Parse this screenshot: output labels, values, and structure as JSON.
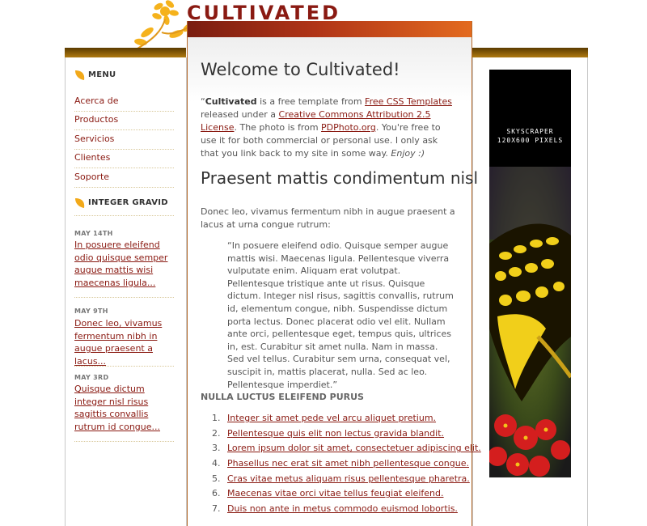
{
  "site": {
    "logo_text": "CULTIVATED"
  },
  "sidebar": {
    "menu_heading": "MENU",
    "menu_items": [
      "Acerca de",
      "Productos",
      "Servicios",
      "Clientes",
      "Soporte"
    ],
    "news_heading": "INTEGER GRAVID",
    "news": [
      {
        "date": "MAY 14TH",
        "text": "In posuere eleifend odio quisque semper augue mattis wisi maecenas ligula..."
      },
      {
        "date": "MAY 9TH",
        "text": "Donec leo, vivamus fermentum nibh in augue praesent a lacus..."
      },
      {
        "date": "MAY 3RD",
        "text": "Quisque dictum integer nisl risus sagittis convallis rutrum id congue..."
      }
    ]
  },
  "main": {
    "title": "Welcome to Cultivated!",
    "intro": {
      "quote_open": "“",
      "brand": "Cultivated",
      "t1": " is a free template from ",
      "link1": "Free CSS Templates",
      "t2": " released under a ",
      "link2": "Creative Commons Attribution 2.5 License",
      "t3": ". The photo is from ",
      "link3": "PDPhoto.org",
      "t4": ". You're free to use it for both commercial or personal use. I only ask that you link back to my site in some way. ",
      "enjoy": "Enjoy :)"
    },
    "subtitle": "Praesent mattis condimentum nisl",
    "paragraph": "Donec leo, vivamus fermentum nibh in augue praesent a lacus at urna congue rutrum:",
    "blockquote": "“In posuere eleifend odio. Quisque semper augue mattis wisi. Maecenas ligula. Pellentesque viverra vulputate enim. Aliquam erat volutpat. Pellentesque tristique ante ut risus. Quisque dictum. Integer nisl risus, sagittis convallis, rutrum id, elementum congue, nibh. Suspendisse dictum porta lectus. Donec placerat odio vel elit. Nullam ante orci, pellentesque eget, tempus quis, ultrices in, est. Curabitur sit amet nulla. Nam in massa. Sed vel tellus. Curabitur sem urna, consequat vel, suscipit in, mattis placerat, nulla. Sed ac leo. Pellentesque imperdiet.”",
    "list_heading": "NULLA LUCTUS ELEIFEND PURUS",
    "list": [
      {
        "num": "1.",
        "text": "Integer sit amet pede vel arcu aliquet pretium."
      },
      {
        "num": "2.",
        "text": "Pellentesque quis elit non lectus gravida blandit."
      },
      {
        "num": "3.",
        "text": "Lorem ipsum dolor sit amet, consectetuer adipiscing elit."
      },
      {
        "num": "4.",
        "text": "Phasellus nec erat sit amet nibh pellentesque congue."
      },
      {
        "num": "5.",
        "text": "Cras vitae metus aliquam risus pellentesque pharetra."
      },
      {
        "num": "6.",
        "text": "Maecenas vitae orci vitae tellus feugiat eleifend."
      },
      {
        "num": "7.",
        "text": "Duis non ante in metus commodo euismod lobortis."
      }
    ]
  },
  "ad": {
    "line1": "SKYSCRAPER",
    "line2": "120X600 PIXELS"
  },
  "colors": {
    "link": "#8a1a12",
    "accent": "#e36a1f",
    "band": "#7a5008",
    "leaf": "#f2a91a"
  },
  "icons": {
    "logo": "flower-logo-icon",
    "section": "leaf-icon"
  }
}
